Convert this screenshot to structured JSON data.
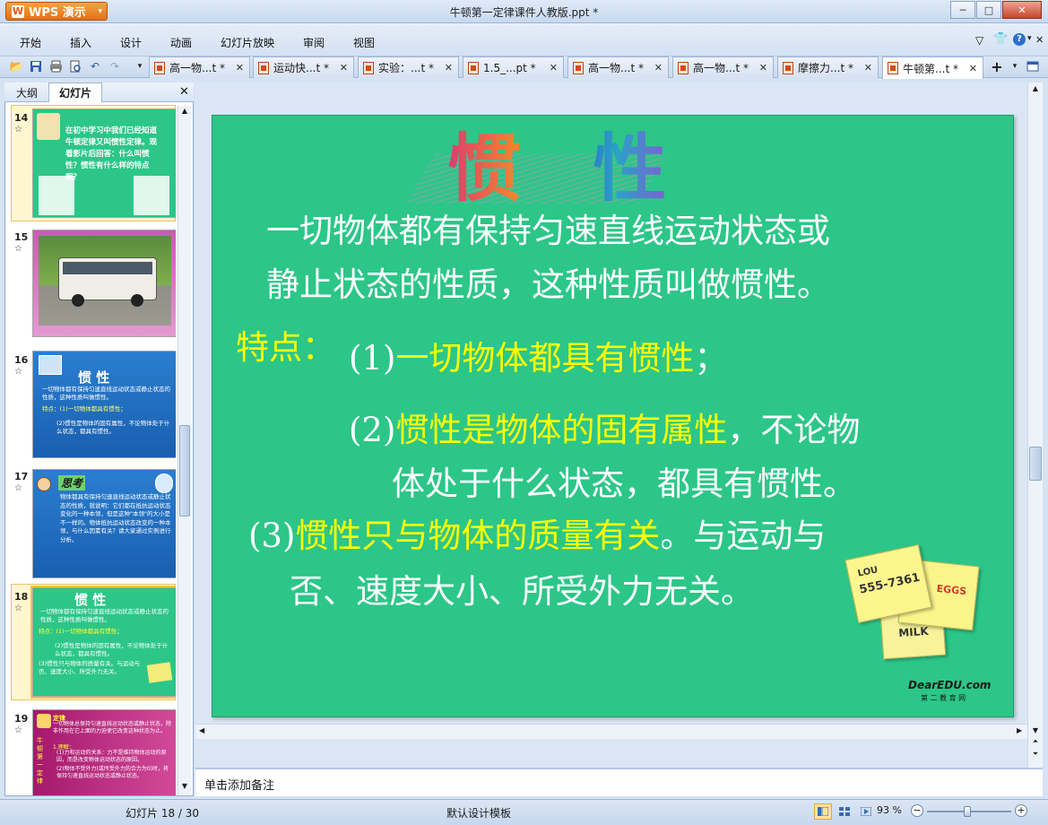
{
  "app": {
    "name": "WPS 演示",
    "title": "牛顿第一定律课件人教版.ppt *"
  },
  "window_buttons": [
    "─",
    "□",
    "✕"
  ],
  "menu": [
    "开始",
    "插入",
    "设计",
    "动画",
    "幻灯片放映",
    "审阅",
    "视图"
  ],
  "tabs": [
    {
      "label": "高一物...t *"
    },
    {
      "label": "运动快...t *"
    },
    {
      "label": "实验：...t *"
    },
    {
      "label": "1.5_...pt *"
    },
    {
      "label": "高一物...t *"
    },
    {
      "label": "高一物...t *"
    },
    {
      "label": "摩擦力...t *"
    },
    {
      "label": "牛顿第...t *"
    }
  ],
  "left_panel": {
    "tab_outline": "大纲",
    "tab_slides": "幻灯片",
    "slides": [
      {
        "num": "14",
        "star": "☆",
        "text": "在初中学习中我们已经知道牛顿定律又叫惯性定律。观看影片后回答：什么叫惯性？惯性有什么样的特点呢？"
      },
      {
        "num": "15",
        "star": "☆"
      },
      {
        "num": "16",
        "star": "☆",
        "title": "惯  性",
        "text": "一切物体都有保持匀速直线运动状态或静止状态的性质，这种性质叫做惯性。",
        "p1": "特点：(1)一切物体都具有惯性；",
        "p2": "(2)惯性是物体的固有属性，不论物体处于什么状态，都具有惯性。"
      },
      {
        "num": "17",
        "star": "☆",
        "heading": "思考",
        "text": "物体都具有保持匀速直线运动状态或静止状态的性质，就说明：它们都在抵抗运动状态变化的一种本领，但是这种\"本领\"的大小是不一样的。物体抵抗运动状态改变的一种本领，与什么因素有关？请大家通过实例进行分析。"
      },
      {
        "num": "18",
        "star": "☆",
        "title": "惯  性",
        "text": "一切物体都有保持匀速直线运动状态或静止状态的性质，这种性质叫做惯性。",
        "p1": "特点：(1)一切物体都具有惯性；",
        "p2": "(2)惯性是物体的固有属性，不论物体处于什么状态，都具有惯性。",
        "p3": "(3)惯性只与物体的质量有关。与运动与否、速度大小、所受外力无关。"
      },
      {
        "num": "19",
        "star": "☆",
        "heading": "定律",
        "text": "一切物体总保持匀速直线运动状态或静止状态，除非作用在它上面的力迫使它改变这种状态为止。",
        "sub1": "1.理解：",
        "sub2": "(1)力和运动的关系：力不是维持物体运动的原因，而是改变物体运动状态的原因。",
        "sub3": "(2)物体不受外力(或所受外力的合力为0)时，将保持匀速直线运动状态或静止状态。",
        "side": "牛顿第一定律"
      }
    ]
  },
  "slide": {
    "title": "惯  性",
    "line1": "一切物体都有保持匀速直线运动状态或",
    "line2": "静止状态的性质，这种性质叫做惯性。",
    "feature_label": "特点：",
    "p1_num": "(1)",
    "p1_yellow": "一切物体都具有惯性",
    "p1_end": "；",
    "p2_num": "(2)",
    "p2_yellow": "惯性是物体的固有属性",
    "p2_end": "，不论物",
    "p2_line2": "体处于什么状态，都具有惯性。",
    "p3_num": "(3)",
    "p3_yellow": "惯性只与物体的质量有关",
    "p3_end": "。与运动与",
    "p3_line2": "否、速度大小、所受外力无关。",
    "note_lou": "LOU",
    "note_phone": "555-7361",
    "note_eggs": "EGGS",
    "note_milk": "MILK",
    "watermark": "DearEDU.com",
    "watermark_sub": "第 二 教 育 网"
  },
  "notes_placeholder": "单击添加备注",
  "status": {
    "slide_counter": "幻灯片 18 / 30",
    "template": "默认设计模板",
    "zoom": "93 %"
  },
  "colors": {
    "slide_bg": "#2cc688",
    "yellow": "#ffff00",
    "accent_orange": "#e0701a"
  }
}
